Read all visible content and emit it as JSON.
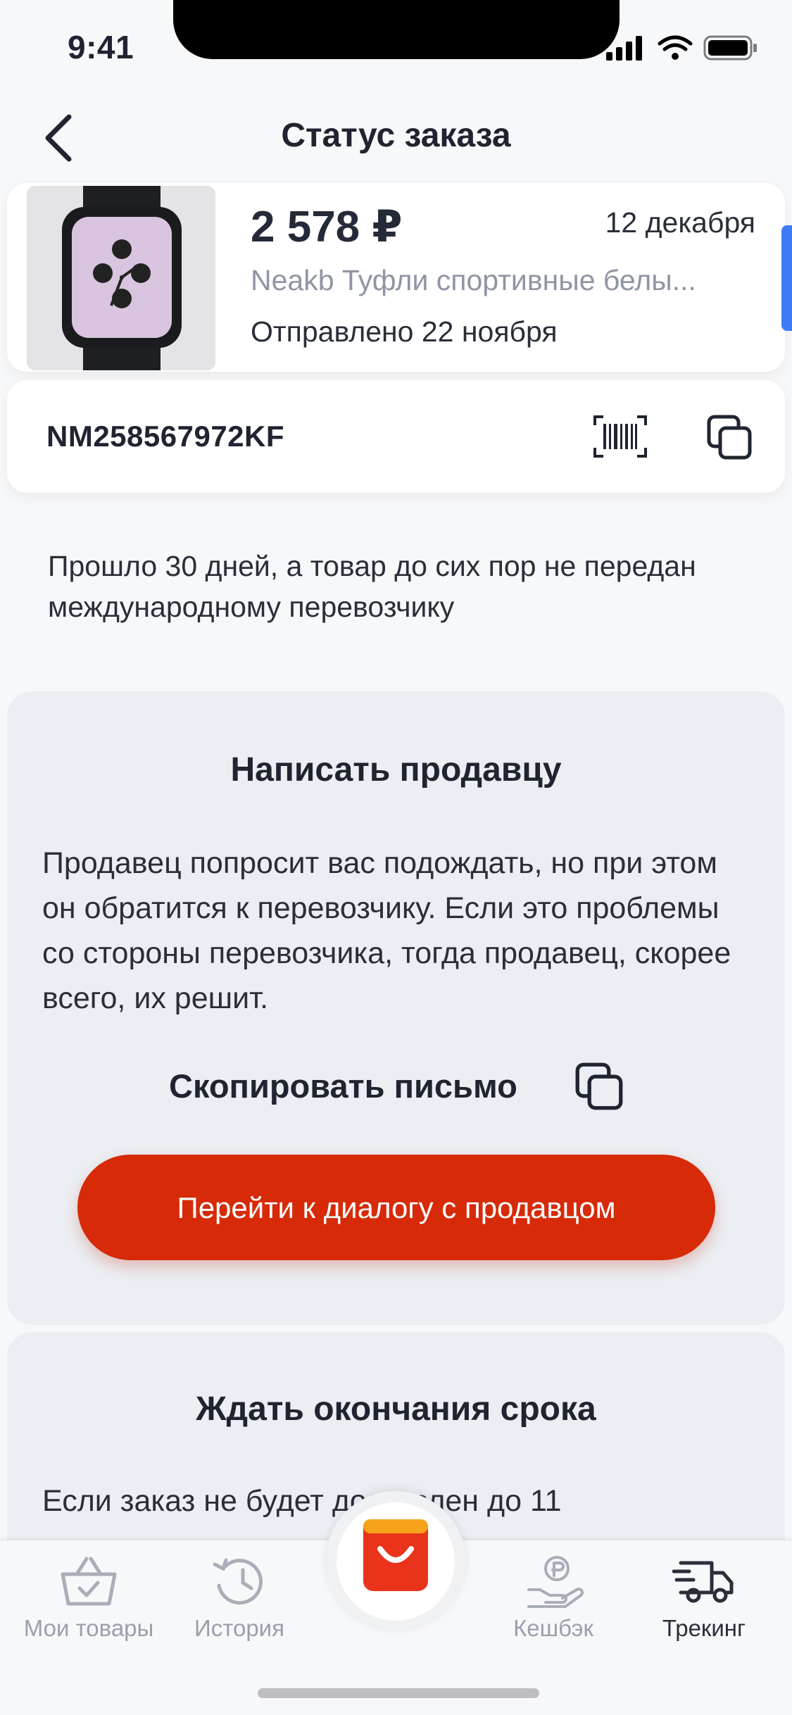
{
  "status_bar": {
    "time": "9:41"
  },
  "header": {
    "title": "Статус заказа"
  },
  "order": {
    "price": "2 578 ₽",
    "date": "12 декабря",
    "product_name": "Neakb Туфли спортивные белы...",
    "shipped": "Отправлено 22 ноября",
    "tracking_number": "NM258567972KF"
  },
  "info_text": "Прошло 30 дней, а товар до сих пор не передан международному перевозчику",
  "write_seller": {
    "title": "Написать продавцу",
    "text": "Продавец попросит вас подождать, но при этом он обратится к перевозчику. Если это проблемы со стороны перевозчика, тогда продавец, скорее всего, их решит.",
    "copy_label": "Скопировать письмо",
    "cta_label": "Перейти к диалогу с продавцом"
  },
  "wait_section": {
    "title": "Ждать окончания срока",
    "text": "Если заказ не будет доставлен до 11"
  },
  "tabs": [
    {
      "label": "Мои товары",
      "icon": "basket-icon"
    },
    {
      "label": "История",
      "icon": "history-icon"
    },
    {
      "label": "",
      "icon": "aliexpress-bag-icon"
    },
    {
      "label": "Кешбэк",
      "icon": "cashback-icon"
    },
    {
      "label": "Трекинг",
      "icon": "truck-icon"
    }
  ],
  "colors": {
    "accent": "#d72a08",
    "text": "#1f2430",
    "muted": "#9aa0ab",
    "link": "#3d7bf4"
  }
}
